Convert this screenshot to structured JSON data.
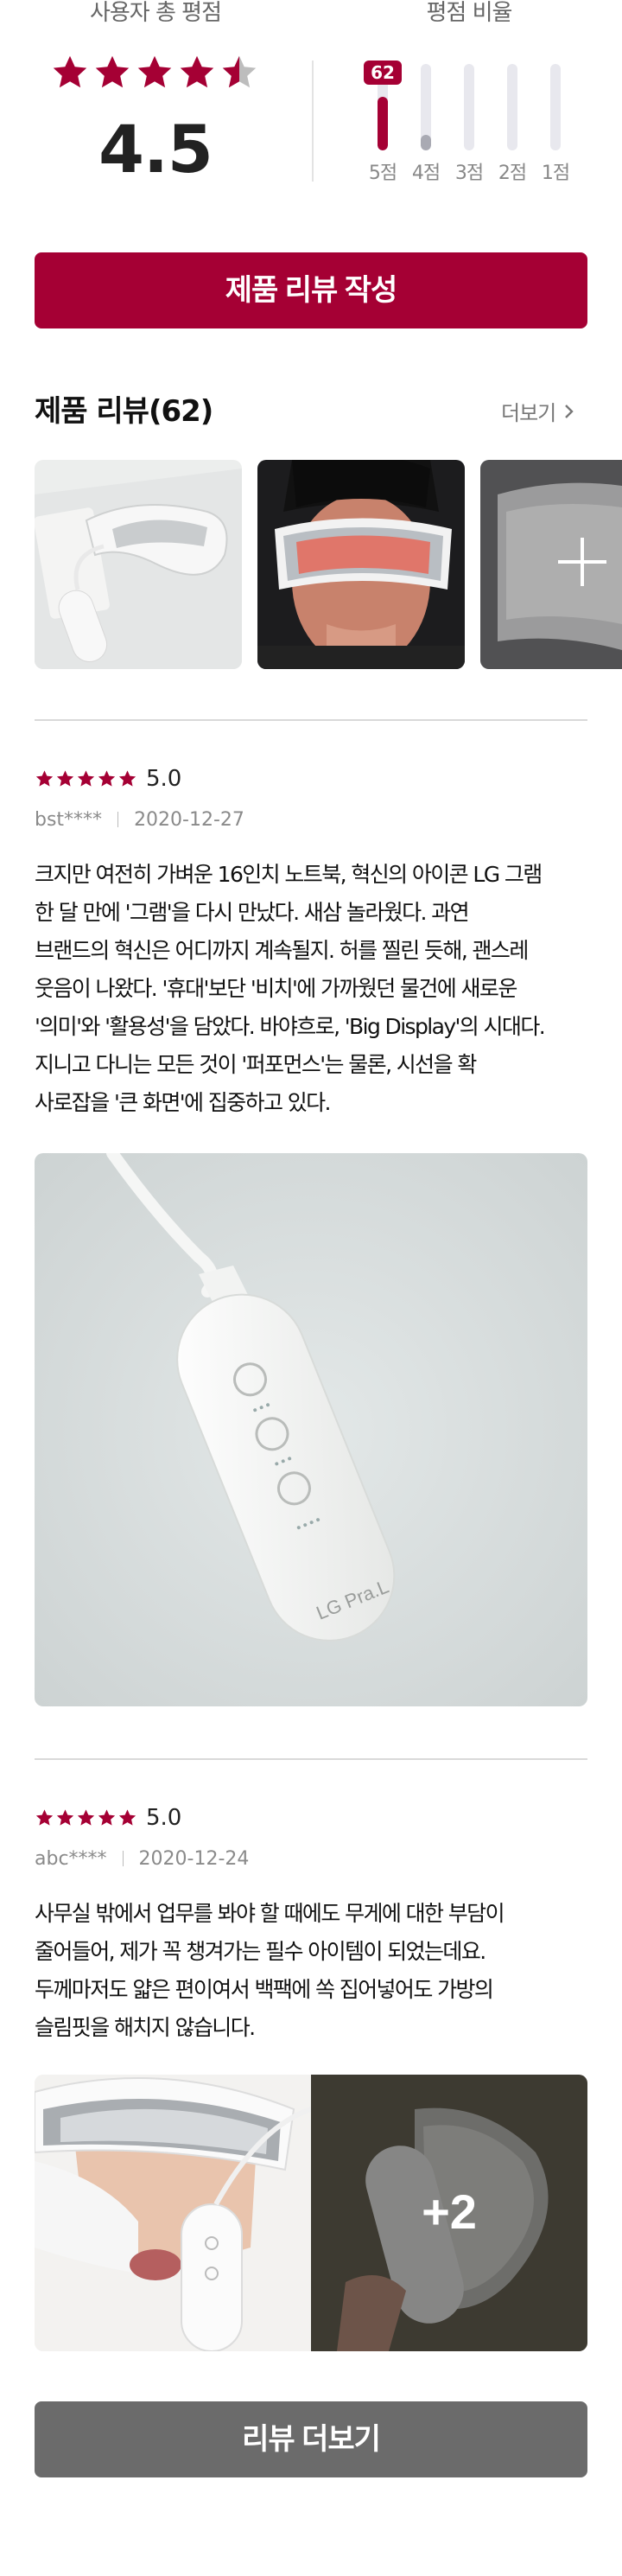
{
  "summary": {
    "total_label": "사용자 총 평점",
    "ratio_label": "평점 비율",
    "average": "4.5",
    "average_value": 4.5,
    "stars_max": 5,
    "distribution": [
      {
        "label": "5점",
        "fraction": 0.62,
        "badge": "62"
      },
      {
        "label": "4점",
        "fraction": 0.18
      },
      {
        "label": "3점",
        "fraction": 0.0
      },
      {
        "label": "2점",
        "fraction": 0.0
      },
      {
        "label": "1점",
        "fraction": 0.0
      }
    ]
  },
  "write_button": "제품 리뷰 작성",
  "reviews_section": {
    "title": "제품 리뷰(62)",
    "more": "더보기",
    "thumbnails": [
      "device-on-table-photo",
      "man-wearing-mask-photo",
      "mask-closeup-photo"
    ]
  },
  "reviews": [
    {
      "stars": 5,
      "score": "5.0",
      "user": "bst****",
      "date": "2020-12-27",
      "text": "크지만 여전히 가벼운 16인치 노트북, 혁신의 아이콘 LG 그램\n한 달 만에 '그램'을 다시 만났다. 새삼 놀라웠다.  과연\n브랜드의 혁신은 어디까지 계속될지. 허를 찔린 듯해, 괜스레\n웃음이 나왔다.  '휴대'보단 '비치'에 가까웠던 물건에 새로운\n'의미'와 '활용성'을 담았다. 바야흐로, 'Big Display'의 시대다.\n지니고 다니는 모든 것이 '퍼포먼스'는 물론, 시선을 확\n사로잡을 '큰 화면'에 집중하고 있다.",
      "image_label": "LG Pra.L"
    },
    {
      "stars": 5,
      "score": "5.0",
      "user": "abc****",
      "date": "2020-12-24",
      "text": "사무실 밖에서 업무를 봐야 할 때에도 무게에 대한 부담이\n줄어들어, 제가 꼭 챙겨가는 필수 아이템이 되었는데요.\n두께마저도 얇은 편이여서 백팩에 쏙 집어넣어도 가방의\n슬림핏을 해치지 않습니다.",
      "extra_count": "+2"
    }
  ],
  "more_reviews_button": "리뷰 더보기",
  "colors": {
    "accent": "#a50034",
    "gray_button": "#6b6b6b",
    "star_empty": "#bdbdbd"
  }
}
